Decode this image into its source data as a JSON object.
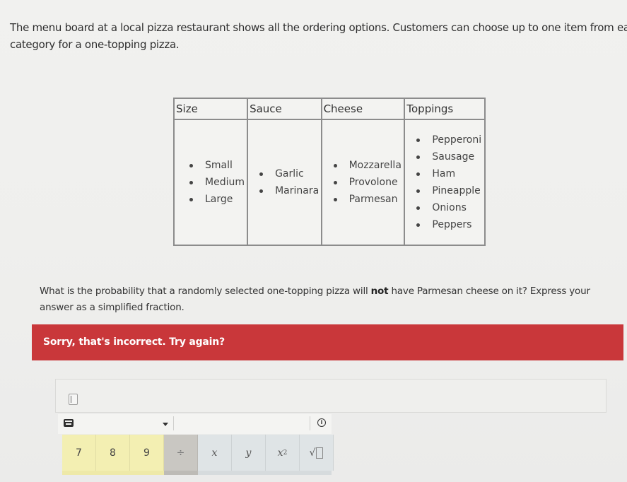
{
  "intro": {
    "line1": "The menu board at a local pizza restaurant shows all the ordering options.  Customers can choose up to one item from each",
    "line2": "category for a one-topping pizza."
  },
  "menu_table": {
    "headers": [
      "Size",
      "Sauce",
      "Cheese",
      "Toppings"
    ],
    "columns": [
      {
        "name": "Size",
        "items": [
          "Small",
          "Medium",
          "Large"
        ]
      },
      {
        "name": "Sauce",
        "items": [
          "Garlic",
          "Marinara"
        ]
      },
      {
        "name": "Cheese",
        "items": [
          "Mozzarella",
          "Provolone",
          "Parmesan"
        ]
      },
      {
        "name": "Toppings",
        "items": [
          "Pepperoni",
          "Sausage",
          "Ham",
          "Pineapple",
          "Onions",
          "Peppers"
        ]
      }
    ]
  },
  "question": {
    "part1": "What is the probability that a randomly selected one-topping pizza will ",
    "emphasis": "not",
    "part2": " have Parmesan cheese on it?  Express your",
    "line2": "answer as a simplified fraction."
  },
  "feedback": {
    "message": "Sorry, that's incorrect. Try again?",
    "color": "#c9373a"
  },
  "answer": {
    "value": ""
  },
  "keypad_toolbar": {
    "keyboard_icon": "keyboard-icon",
    "dropdown_icon": "caret-down-icon",
    "info_icon": "info-icon",
    "info_glyph": "i"
  },
  "keypad": {
    "keys": [
      {
        "label": "7",
        "type": "num"
      },
      {
        "label": "8",
        "type": "num"
      },
      {
        "label": "9",
        "type": "num"
      },
      {
        "label": "÷",
        "type": "op"
      },
      {
        "label": "x",
        "type": "var"
      },
      {
        "label": "y",
        "type": "var"
      },
      {
        "label": "x",
        "sup": "2",
        "type": "var"
      },
      {
        "label": "√",
        "type": "var"
      }
    ],
    "colors": {
      "num": "#f3efb2",
      "op": "#c9c7c2",
      "var": "#dfe4e6"
    }
  }
}
